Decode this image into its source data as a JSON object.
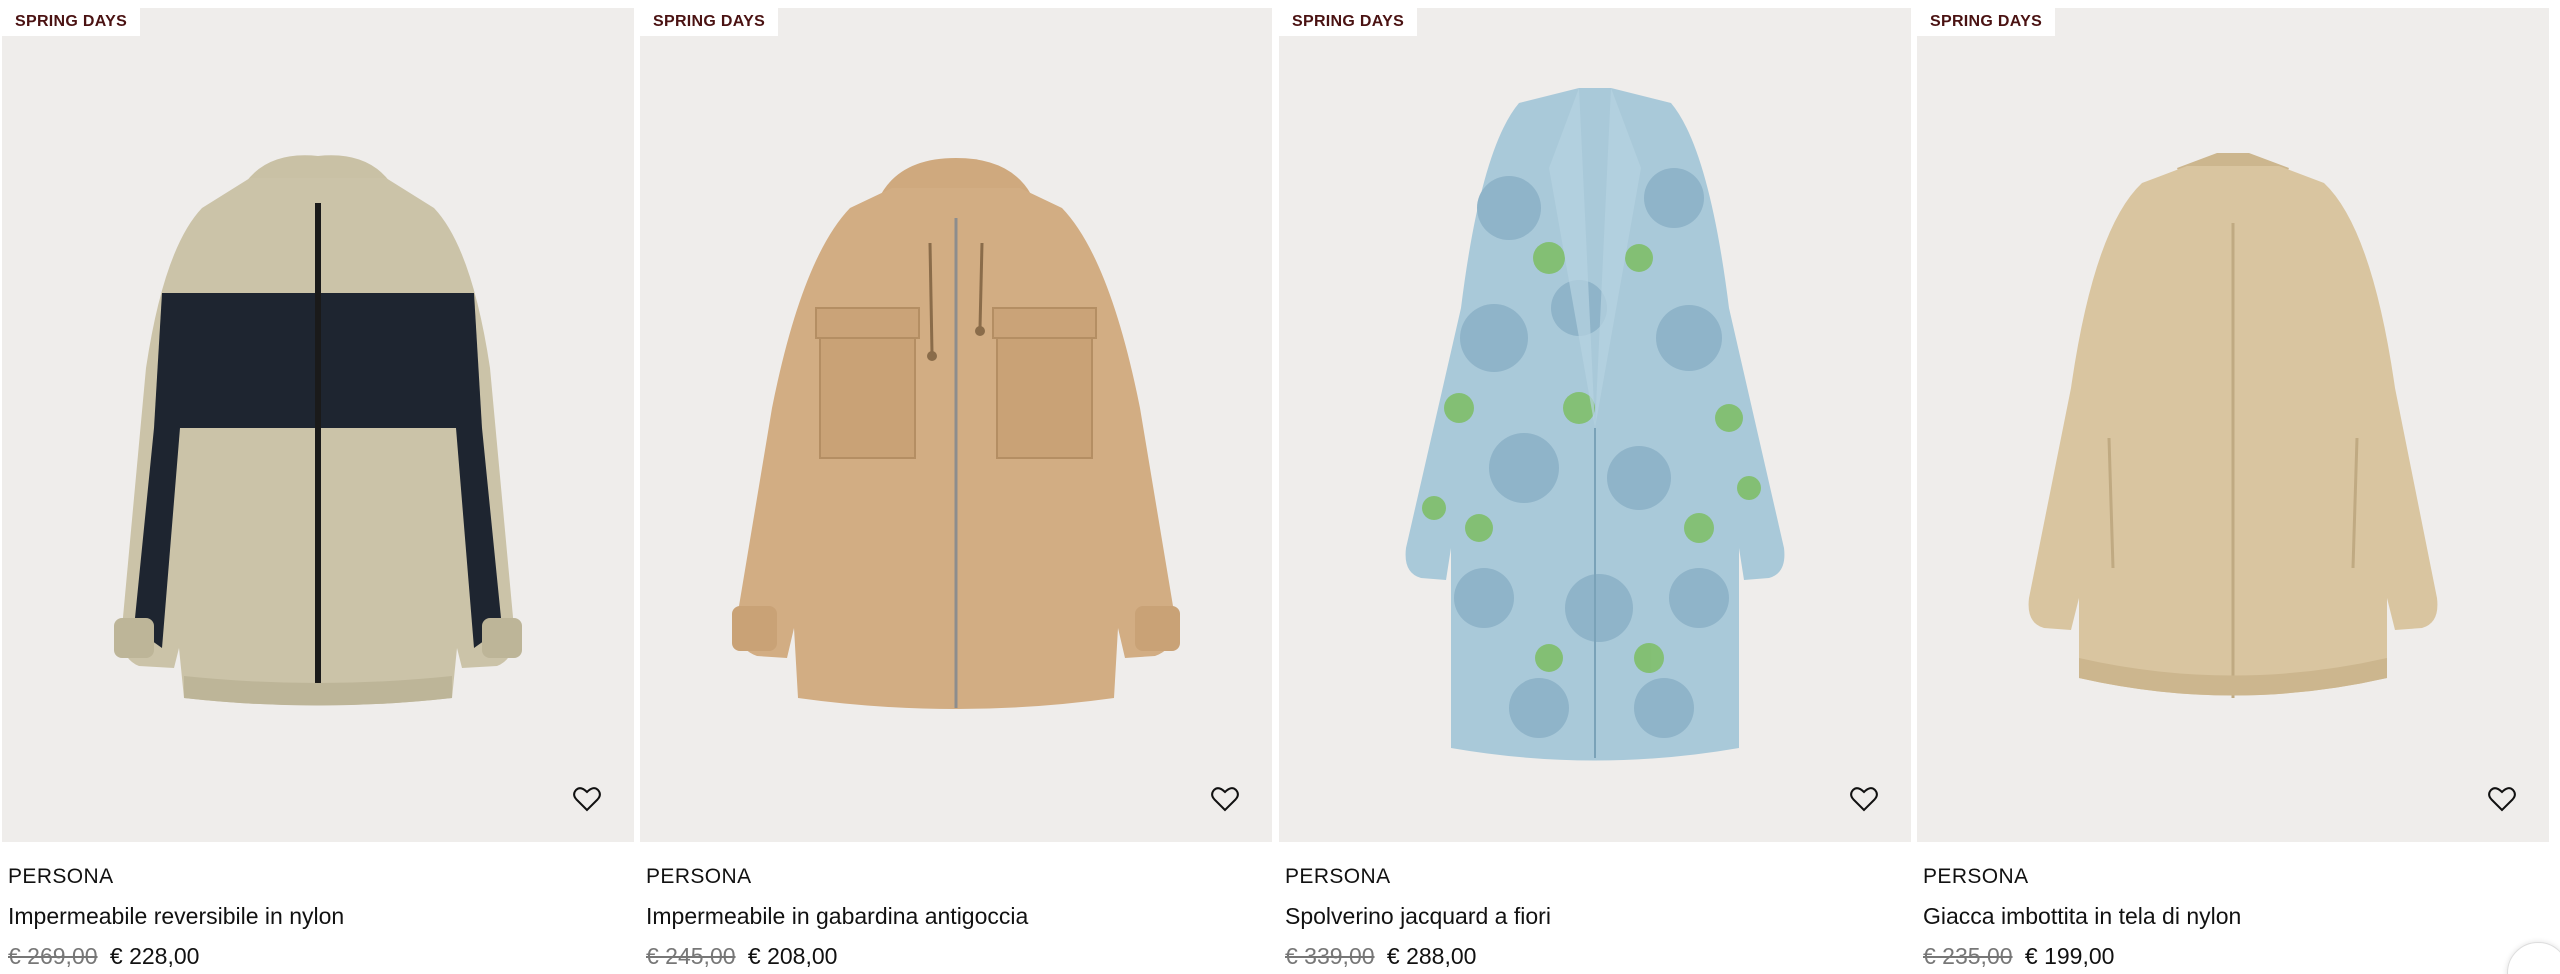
{
  "products": [
    {
      "badge": "SPRING DAYS",
      "brand": "PERSONA",
      "name": "Impermeabile reversibile in nylon",
      "old_price": "€ 269,00",
      "new_price": "€ 228,00",
      "image_icon": "reversible-nylon-jacket-image",
      "colors": [
        "#cbc3a8",
        "#1e2530"
      ]
    },
    {
      "badge": "SPRING DAYS",
      "brand": "PERSONA",
      "name": "Impermeabile in gabardina antigoccia",
      "old_price": "€ 245,00",
      "new_price": "€ 208,00",
      "image_icon": "gabardine-raincoat-image",
      "colors": [
        "#d2ad83"
      ]
    },
    {
      "badge": "SPRING DAYS",
      "brand": "PERSONA",
      "name": "Spolverino jacquard a fiori",
      "old_price": "€ 339,00",
      "new_price": "€ 288,00",
      "image_icon": "floral-jacquard-duster-image",
      "colors": [
        "#a8c8d8",
        "#7fbf6a"
      ]
    },
    {
      "badge": "SPRING DAYS",
      "brand": "PERSONA",
      "name": "Giacca imbottita in tela di nylon",
      "old_price": "€ 235,00",
      "new_price": "€ 199,00",
      "image_icon": "padded-nylon-jacket-image",
      "colors": [
        "#d9c5a0"
      ]
    }
  ],
  "icons": {
    "wishlist": "heart-icon"
  },
  "theme": {
    "image_background": "#efedeb",
    "badge_text": "#4a1212",
    "old_price": "#777777"
  }
}
